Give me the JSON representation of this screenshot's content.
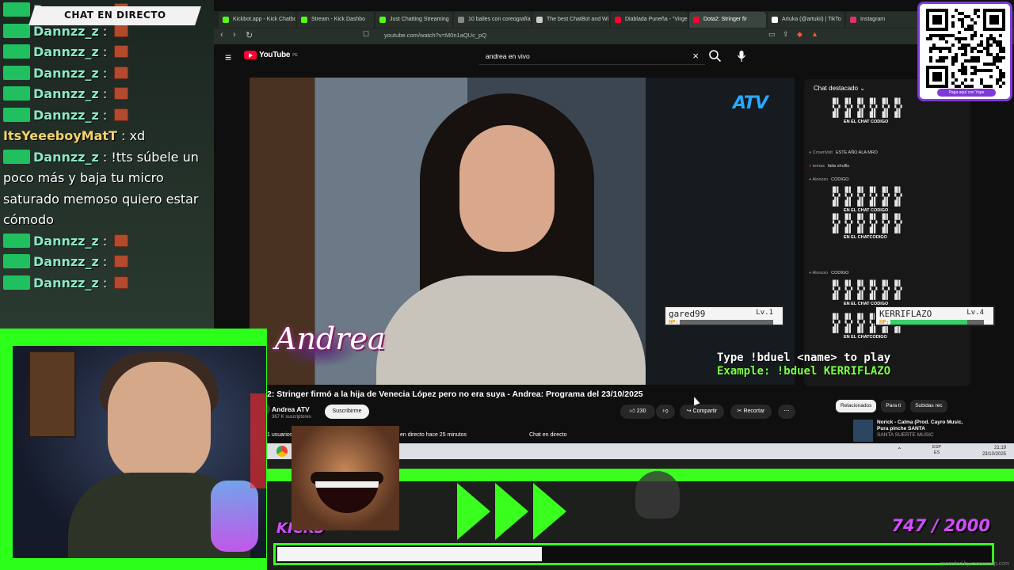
{
  "chat_overlay": {
    "title": "CHAT EN DIRECTO",
    "messages": [
      {
        "user": "Dannzz_z",
        "text": ""
      },
      {
        "user": "Dannzz_z",
        "text": ""
      },
      {
        "user": "Dannzz_z",
        "text": ""
      },
      {
        "user": "Dannzz_z",
        "text": ""
      },
      {
        "user": "Dannzz_z",
        "text": ""
      },
      {
        "user": "Dannzz_z",
        "text": ""
      },
      {
        "user": "ItsYeeeboyMatT",
        "text": "xd"
      },
      {
        "user": "Dannzz_z",
        "text": "!tts súbele un poco más y baja tu micro saturado memoso quiero estar cómodo"
      },
      {
        "user": "Dannzz_z",
        "text": ""
      },
      {
        "user": "Dannzz_z",
        "text": ""
      },
      {
        "user": "Dannzz_z",
        "text": ""
      }
    ]
  },
  "browser": {
    "tabs": [
      {
        "label": "Kickbot.app - Kick Chatbot",
        "color": "#53fc18"
      },
      {
        "label": "Stream - Kick Dashbo",
        "color": "#53fc18"
      },
      {
        "label": "Just Chatting Streaming",
        "color": "#53fc18"
      },
      {
        "label": "10 bailes con coreografía",
        "color": "#888888"
      },
      {
        "label": "The best ChatBot and Wi",
        "color": "#cccccc"
      },
      {
        "label": "Diablada Puneña - \"Virge",
        "color": "#ff0033"
      },
      {
        "label": "Dota2: Stringer fir",
        "color": "#ff0033"
      },
      {
        "label": "Artuka (@artukii) | TikTo",
        "color": "#ffffff"
      },
      {
        "label": "Instagram",
        "color": "#e1306c"
      }
    ],
    "active_tab": 6,
    "url": "youtube.com/watch?v=M0n1aQUc_pQ"
  },
  "youtube": {
    "logo": "YouTube",
    "logo_region": "PE",
    "search_query": "andrea en vivo",
    "video_title": "2: Stringer firmó a la hija de Venecia López pero no era suya - Andrea: Programa del 23/10/2025",
    "channel_name": "Andrea ATV",
    "channel_subs": "367 K suscriptores",
    "subscribe_label": "Suscribirme",
    "likes": "230",
    "share_label": "Compartir",
    "clip_label": "Recortar",
    "live_users": "1 usuarios",
    "live_since": "en directo hace 25 minutos",
    "live_chat_label": "Chat en directo",
    "featured_chat_title": "Chat destacado",
    "chat_messages": [
      {
        "user": "CrownVolt",
        "text": "ESTE AÑO ALA MRD"
      },
      {
        "user": "tomas",
        "text": "falta shullls"
      },
      {
        "user": "Alonzzo",
        "text": "CODIGO"
      },
      {
        "user": "Alonzzo",
        "text": "CODIGO"
      }
    ],
    "ascii_caption_a": "EN EL CHAT CODIGO",
    "ascii_caption_b": "EN EL CHATCODIGO",
    "side_tabs": [
      "Relacionados",
      "Para ti",
      "Subidas rec"
    ],
    "reco_title": "Norick - Calma (Prod. Cayro Music, Pura pinche SANTA",
    "reco_channel": "SANTA SUERTE MUSIC",
    "video_logos": {
      "atv": "ATV",
      "show": "Andrea"
    }
  },
  "duel": {
    "player1": {
      "name": "gared99",
      "level": "Lv.1",
      "hp_label": "HP:",
      "hp": 0.0
    },
    "player2": {
      "name": "KERRIFLAZO",
      "level": "Lv.4",
      "hp_label": "HP:",
      "hp": 0.82
    },
    "instruction": "Type !bduel <name> to play",
    "example": "Example: !bduel KERRIFLAZO"
  },
  "taskbar": {
    "lang": "ESP",
    "lang_sub": "ES",
    "time": "21:19",
    "date": "23/10/2025"
  },
  "alert": {
    "label": "KICKS",
    "goal_text": "747 / 2000",
    "progress": 0.3735
  },
  "qr": {
    "caption": "Paga aquí con Yape"
  },
  "watermark": "recorded by monosnap.com",
  "colors": {
    "accent_green": "#3aff1e",
    "accent_purple": "#d44cff",
    "youtube_red": "#ff0033"
  }
}
